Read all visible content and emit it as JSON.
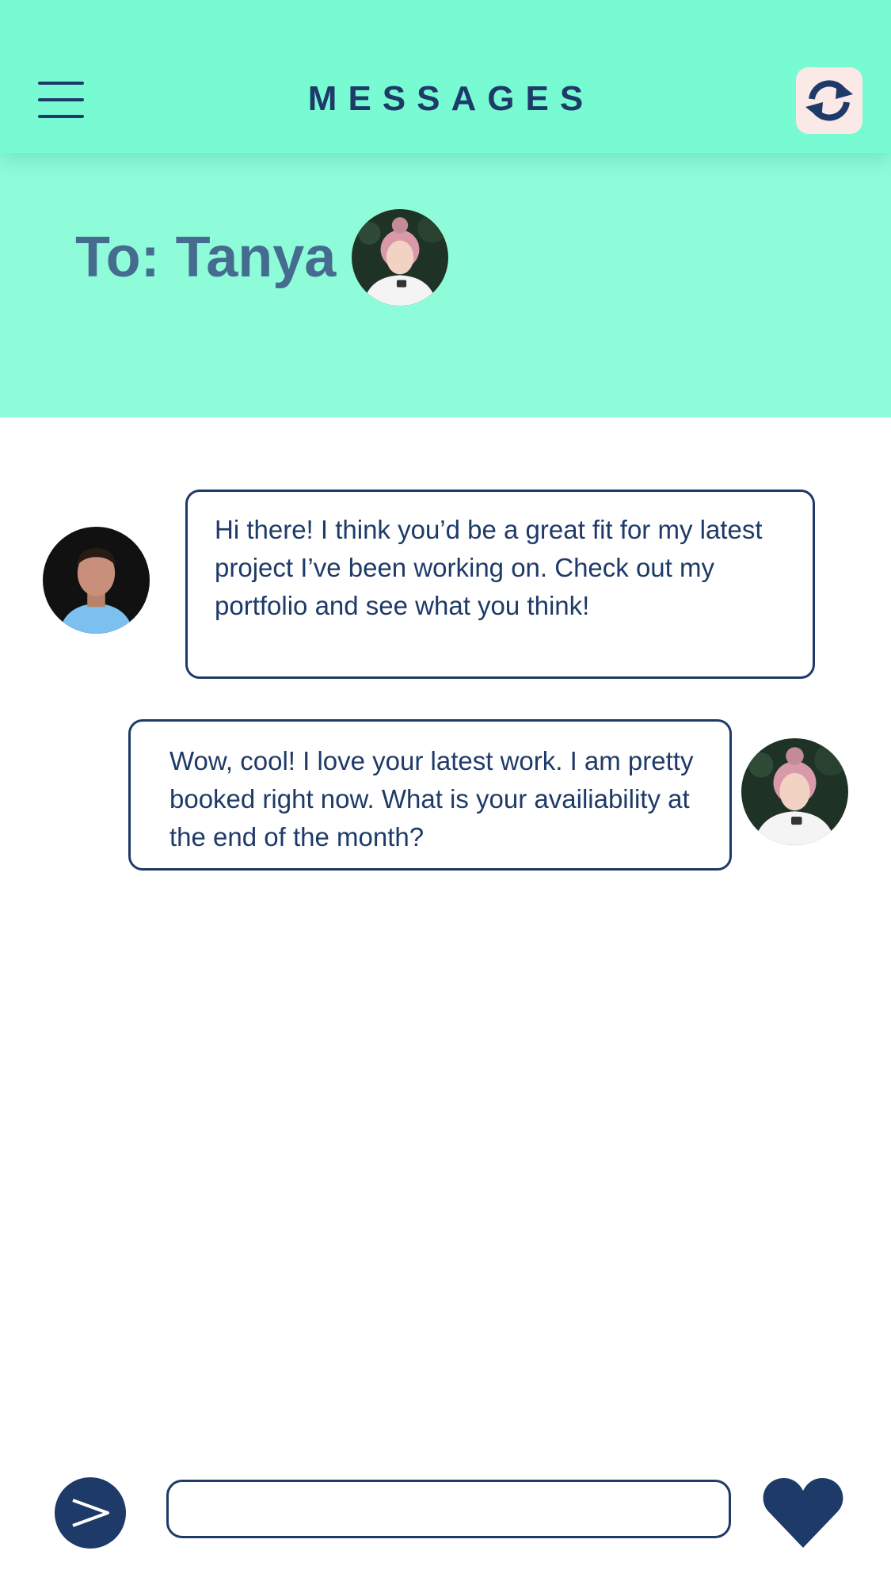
{
  "header": {
    "title": "MESSAGES",
    "menu_icon": "hamburger-menu-icon",
    "refresh_icon": "refresh-icon"
  },
  "recipient": {
    "label": "To: Tanya",
    "avatar": "tanya-avatar"
  },
  "messages": [
    {
      "from": "sender",
      "avatar": "man-avatar",
      "text": "Hi there! I think you’d be a great fit for my latest project I’ve been working on. Check out my portfolio and see what you think!"
    },
    {
      "from": "recipient",
      "avatar": "tanya-avatar",
      "text": "Wow, cool! I love your latest work.  I am pretty booked right now. What is your availiability at the end of the month?"
    }
  ],
  "composer": {
    "value": "",
    "placeholder": "",
    "send_icon": "send-icon",
    "like_icon": "heart-icon"
  },
  "colors": {
    "header_bg": "#78fbd2",
    "band_bg": "#8ffcd9",
    "navy": "#1e3a68",
    "title_slate": "#456c8f"
  }
}
